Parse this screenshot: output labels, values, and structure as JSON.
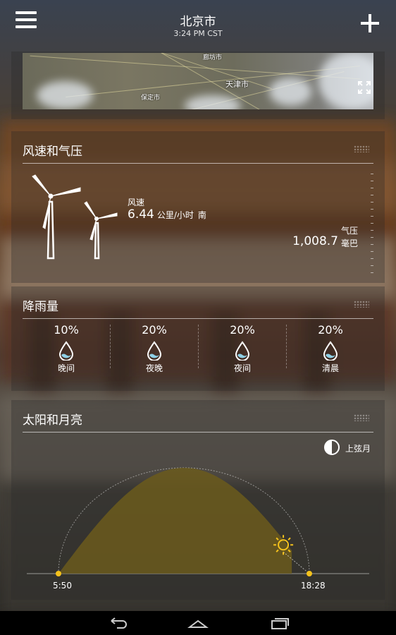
{
  "header": {
    "city": "北京市",
    "time": "3:24 PM CST"
  },
  "map": {
    "labels": [
      "廊坊市",
      "天津市",
      "保定市"
    ]
  },
  "wind": {
    "title": "风速和气压",
    "speed_label": "风速",
    "speed_value": "6.44",
    "speed_unit": "公里/小时",
    "direction": "南",
    "pressure_label": "气压",
    "pressure_value": "1,008.7",
    "pressure_unit": "毫巴"
  },
  "precipitation": {
    "title": "降雨量",
    "periods": [
      {
        "percent": "10%",
        "label": "晚间"
      },
      {
        "percent": "20%",
        "label": "夜晚"
      },
      {
        "percent": "20%",
        "label": "夜间"
      },
      {
        "percent": "20%",
        "label": "清晨"
      }
    ]
  },
  "sun_moon": {
    "title": "太阳和月亮",
    "moon_phase": "上弦月",
    "sunrise": "5:50",
    "sunset": "18:28",
    "day_progress": 0.93
  },
  "colors": {
    "accent": "#f4c21c",
    "arc_fill": "#6b5a1c"
  },
  "icons": {
    "menu": "menu-icon",
    "add": "plus-icon",
    "expand": "expand-icon",
    "back": "back-icon",
    "home": "home-icon",
    "recents": "recents-icon"
  }
}
